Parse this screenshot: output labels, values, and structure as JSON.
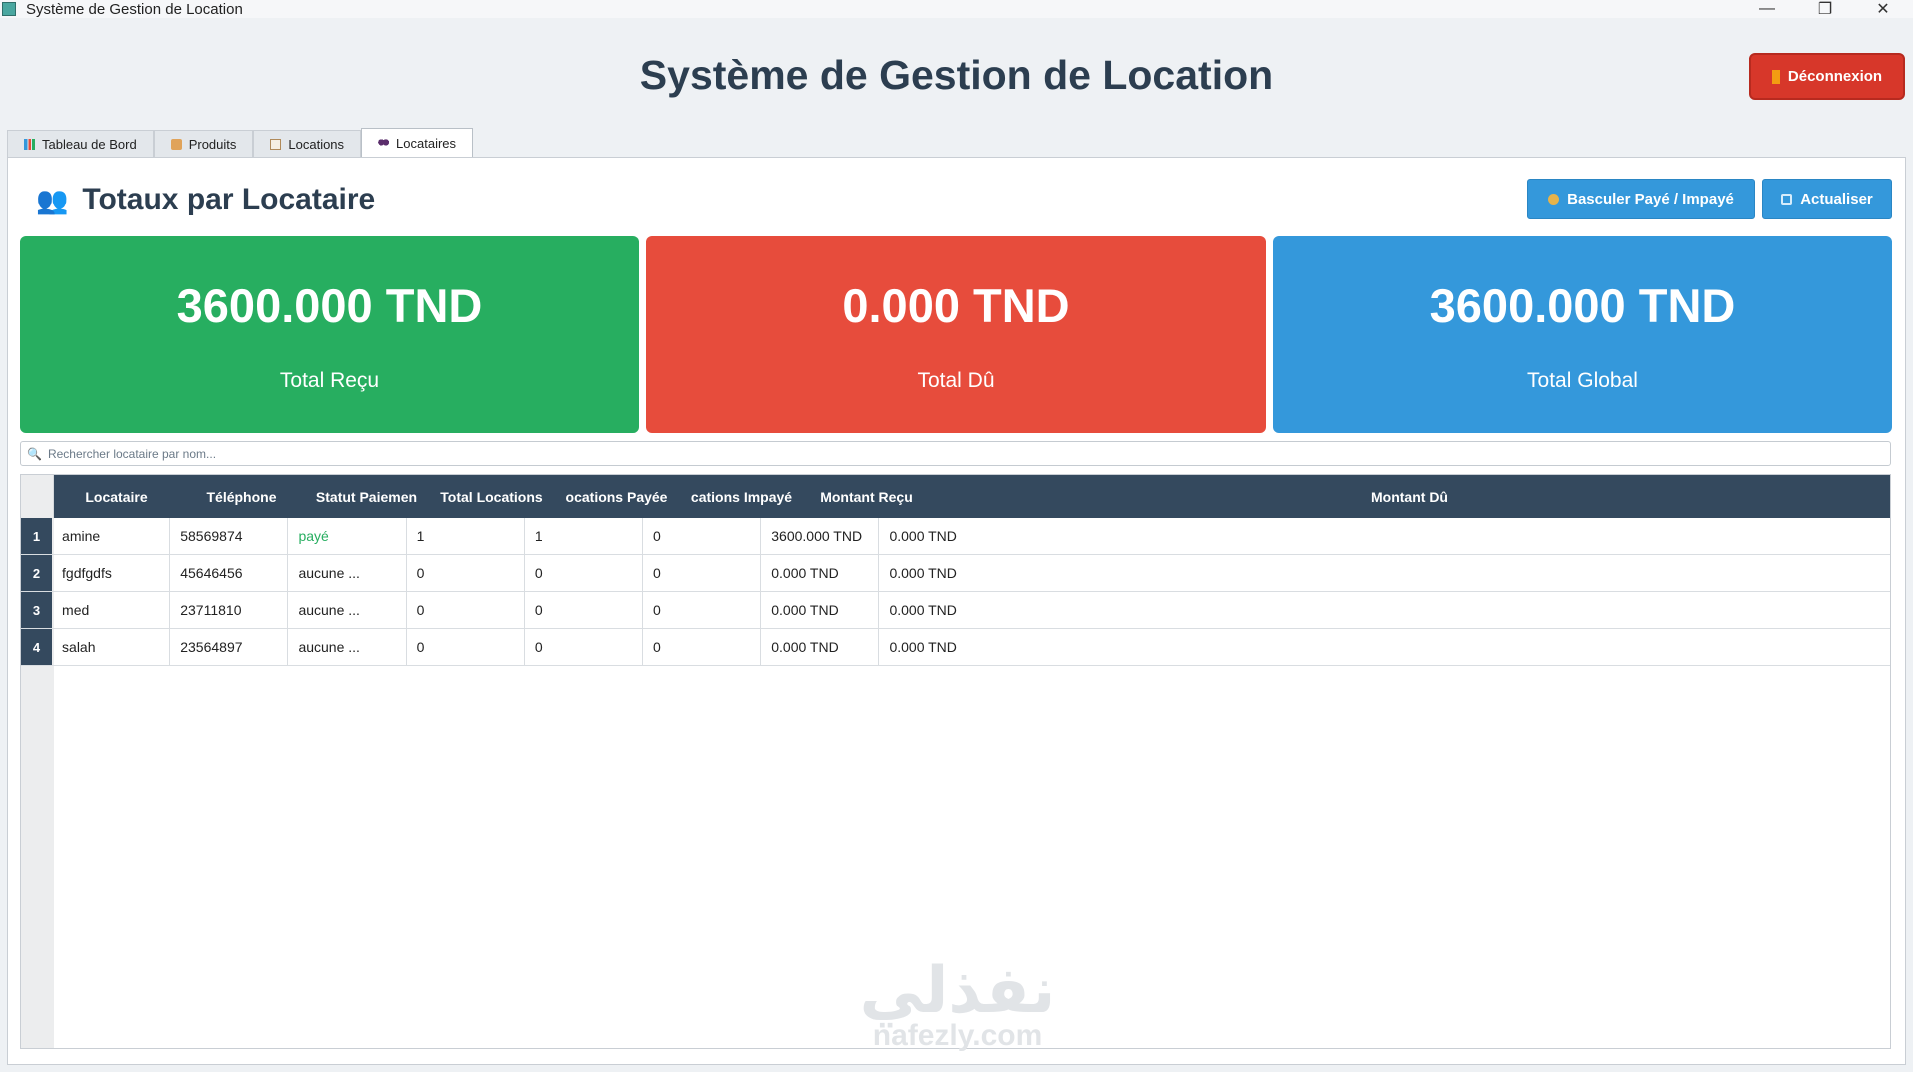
{
  "window": {
    "title": "Système de Gestion de Location",
    "controls": {
      "minimize": "—",
      "maximize": "❐",
      "close": "✕"
    }
  },
  "header": {
    "title": "Système de Gestion de Location",
    "logout_label": "Déconnexion"
  },
  "tabs": [
    {
      "label": "Tableau de Bord",
      "icon": "bar-chart-icon",
      "active": false
    },
    {
      "label": "Produits",
      "icon": "box-icon",
      "active": false
    },
    {
      "label": "Locations",
      "icon": "clipboard-icon",
      "active": false
    },
    {
      "label": "Locataires",
      "icon": "people-icon",
      "active": true
    }
  ],
  "section": {
    "title": "Totaux par Locataire",
    "toggle_label": "Basculer Payé / Impayé",
    "refresh_label": "Actualiser"
  },
  "cards": [
    {
      "amount": "3600.000 TND",
      "label": "Total Reçu",
      "color": "#27ae60"
    },
    {
      "amount": "0.000 TND",
      "label": "Total Dû",
      "color": "#e74c3c"
    },
    {
      "amount": "3600.000 TND",
      "label": "Total Global",
      "color": "#3498db"
    }
  ],
  "search": {
    "placeholder": "Rechercher locataire par nom..."
  },
  "table": {
    "columns": [
      "Locataire",
      "Téléphone",
      "Statut Paiement",
      "Total Locations",
      "Locations Payée",
      "Locations Impayé",
      "Montant Reçu",
      "Montant Dû"
    ],
    "columns_visible": [
      "Locataire",
      "Téléphone",
      "Statut Paiemen",
      "Total Locations",
      "ocations Payée",
      "cations Impayé",
      "Montant Reçu",
      "Montant Dû"
    ],
    "rows": [
      {
        "num": "1",
        "cells": [
          "amine",
          "58569874",
          "payé",
          "1",
          "1",
          "0",
          "3600.000 TND",
          "0.000 TND"
        ]
      },
      {
        "num": "2",
        "cells": [
          "fgdfgdfs",
          "45646456",
          "aucune ...",
          "0",
          "0",
          "0",
          "0.000 TND",
          "0.000 TND"
        ]
      },
      {
        "num": "3",
        "cells": [
          "med",
          "23711810",
          "aucune ...",
          "0",
          "0",
          "0",
          "0.000 TND",
          "0.000 TND"
        ]
      },
      {
        "num": "4",
        "cells": [
          "salah",
          "23564897",
          "aucune ...",
          "0",
          "0",
          "0",
          "0.000 TND",
          "0.000 TND"
        ]
      }
    ]
  },
  "watermark": {
    "arabic": "نفذلي",
    "latin": "nafezly.com"
  },
  "colors": {
    "header_dark": "#34495e",
    "logout_red": "#d7372a",
    "button_blue": "#3498db",
    "paid_green": "#27ae60"
  }
}
